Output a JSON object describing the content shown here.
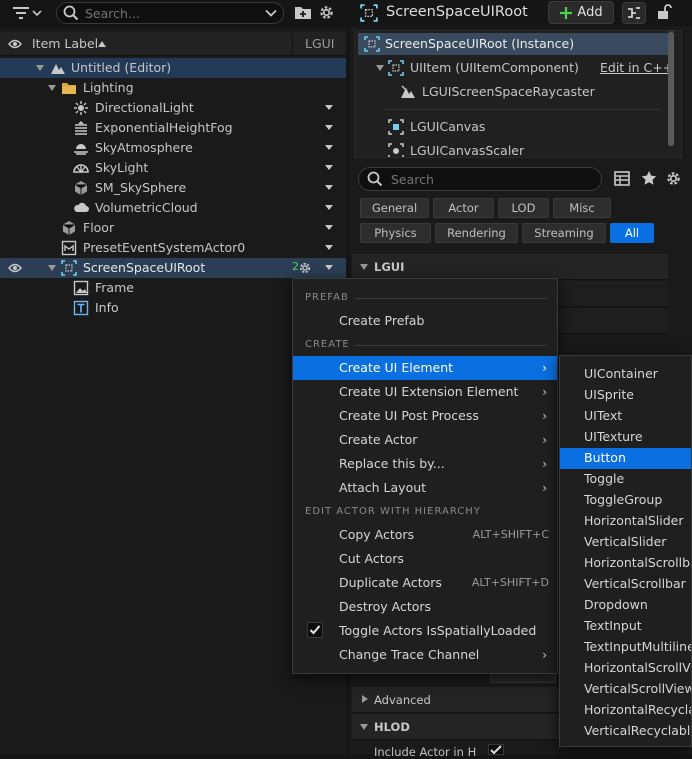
{
  "outliner": {
    "search_placeholder": "Search...",
    "header": {
      "item_label": "Item Label",
      "lgui": "LGUI"
    },
    "rows": [
      {
        "label": "Untitled (Editor)"
      },
      {
        "label": "Lighting"
      },
      {
        "label": "DirectionalLight"
      },
      {
        "label": "ExponentialHeightFog"
      },
      {
        "label": "SkyAtmosphere"
      },
      {
        "label": "SkyLight"
      },
      {
        "label": "SM_SkySphere"
      },
      {
        "label": "VolumetricCloud"
      },
      {
        "label": "Floor"
      },
      {
        "label": "PresetEventSystemActor0"
      },
      {
        "label": "ScreenSpaceUIRoot",
        "badge": "2"
      },
      {
        "label": "Frame"
      },
      {
        "label": "Info"
      }
    ]
  },
  "details": {
    "title": "ScreenSpaceUIRoot",
    "add_label": "Add",
    "component_tree": [
      {
        "label": "ScreenSpaceUIRoot (Instance)"
      },
      {
        "label": "UIItem (UIItemComponent)",
        "link": "Edit in C++"
      },
      {
        "label": "LGUIScreenSpaceRaycaster"
      },
      {
        "label": "LGUICanvas"
      },
      {
        "label": "LGUICanvasScaler"
      }
    ],
    "search_placeholder": "Search",
    "filters_row1": [
      "General",
      "Actor",
      "LOD",
      "Misc"
    ],
    "filters_row2": [
      "Physics",
      "Rendering",
      "Streaming",
      "All"
    ],
    "categories": {
      "lgui": "LGUI",
      "advanced": "Advanced",
      "hlod": "HLOD"
    },
    "include_actor_label": "Include Actor in H"
  },
  "context_menu": {
    "sections": {
      "prefab": "PREFAB",
      "create": "CREATE",
      "edit": "EDIT ACTOR WITH HIERARCHY"
    },
    "items": {
      "create_prefab": "Create Prefab",
      "create_ui_element": "Create UI Element",
      "create_ui_extension": "Create UI Extension Element",
      "create_ui_post_process": "Create UI Post Process",
      "create_actor": "Create Actor",
      "replace_this_by": "Replace this by...",
      "attach_layout": "Attach Layout",
      "copy_actors": "Copy Actors",
      "copy_shortcut": "ALT+SHIFT+C",
      "cut_actors": "Cut Actors",
      "duplicate_actors": "Duplicate Actors",
      "duplicate_shortcut": "ALT+SHIFT+D",
      "destroy_actors": "Destroy Actors",
      "toggle_spatially_loaded": "Toggle Actors IsSpatiallyLoaded",
      "change_trace_channel": "Change Trace Channel"
    }
  },
  "submenu": {
    "items": [
      "UIContainer",
      "UISprite",
      "UIText",
      "UITexture",
      "Button",
      "Toggle",
      "ToggleGroup",
      "HorizontalSlider",
      "VerticalSlider",
      "HorizontalScrollbar",
      "VerticalScrollbar",
      "Dropdown",
      "TextInput",
      "TextInputMultiline",
      "HorizontalScrollView",
      "VerticalScrollView",
      "HorizontalRecyclableScrollView",
      "VerticalRecyclableScrollView"
    ],
    "highlighted": "Button"
  },
  "colors": {
    "accent": "#0a6fe0",
    "selection": "#2c3e55",
    "folder": "#d9a441"
  }
}
